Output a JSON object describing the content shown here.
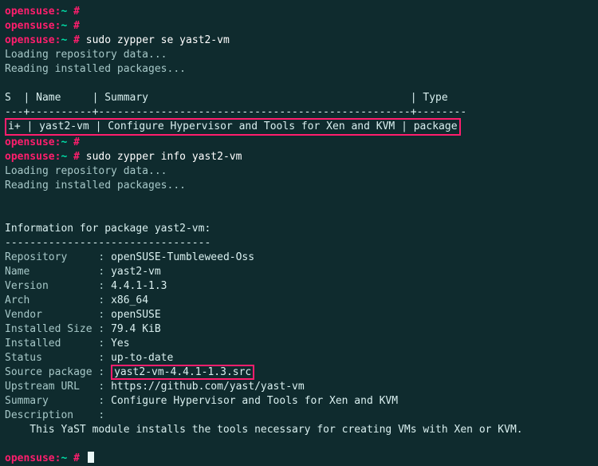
{
  "prompt": {
    "host": "opensuse:",
    "path": "~",
    "hash": " #"
  },
  "cmd1": "sudo zypper se yast2-vm",
  "load1": "Loading repository data...",
  "install1": "Reading installed packages...",
  "table": {
    "header": "S  | Name     | Summary                                          | Type",
    "sep": "---+----------+--------------------------------------------------+--------",
    "row": "i+ | yast2-vm | Configure Hypervisor and Tools for Xen and KVM | package"
  },
  "cmd2": "sudo zypper info yast2-vm",
  "load2": "Loading repository data...",
  "install2": "Reading installed packages...",
  "info": {
    "title": "Information for package yast2-vm:",
    "sep": "---------------------------------",
    "repo_l": "Repository     :",
    "repo_v": "openSUSE-Tumbleweed-Oss",
    "name_l": "Name           :",
    "name_v": "yast2-vm",
    "ver_l": "Version        :",
    "ver_v": "4.4.1-1.3",
    "arch_l": "Arch           :",
    "arch_v": "x86_64",
    "vendor_l": "Vendor         :",
    "vendor_v": "openSUSE",
    "size_l": "Installed Size :",
    "size_v": "79.4 KiB",
    "inst_l": "Installed      :",
    "inst_v": "Yes",
    "stat_l": "Status         :",
    "stat_v": "up-to-date",
    "src_l": "Source package :",
    "src_v": "yast2-vm-4.4.1-1.3.src",
    "url_l": "Upstream URL   :",
    "url_v": "https://github.com/yast/yast-vm",
    "sum_l": "Summary        :",
    "sum_v": "Configure Hypervisor and Tools for Xen and KVM",
    "desc_l": "Description    :",
    "desc_v": "    This YaST module installs the tools necessary for creating VMs with Xen or KVM."
  }
}
